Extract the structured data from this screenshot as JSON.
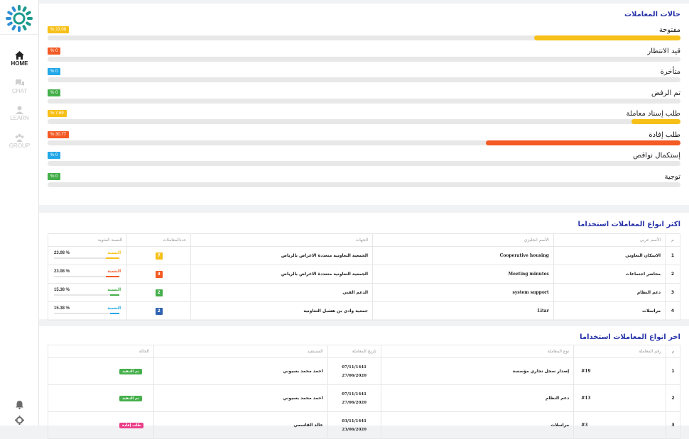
{
  "nav": {
    "items": [
      {
        "label": "HOME",
        "icon": "home-icon",
        "active": true
      },
      {
        "label": "CHAT",
        "icon": "chat-icon",
        "active": false
      },
      {
        "label": "LEARN",
        "icon": "learn-icon",
        "active": false
      },
      {
        "label": "GROUP",
        "icon": "group-icon",
        "active": false
      }
    ],
    "bottom_icons": [
      "bell-icon",
      "gear-icon"
    ]
  },
  "colors": {
    "yellow": "#f7c018",
    "red": "#f35a24",
    "blue": "#22a7e8",
    "green": "#44af4a",
    "darkblue": "#2f62b1",
    "pink": "#ec3f8a",
    "title": "#2633a8"
  },
  "status_card": {
    "title": "حالات المعاملات",
    "rows": [
      {
        "label": "مفتوحة",
        "badge": "% 23.08",
        "percent": 23.08,
        "color": "#f7c018"
      },
      {
        "label": "قيد الانتظار",
        "badge": "% 0",
        "percent": 0,
        "color": "#f35a24"
      },
      {
        "label": "متأخرة",
        "badge": "% 0",
        "percent": 0,
        "color": "#22a7e8"
      },
      {
        "label": "تم الرفض",
        "badge": "% 0",
        "percent": 0,
        "color": "#44af4a"
      },
      {
        "label": "طلب إسناد معاملة",
        "badge": "% 7.69",
        "percent": 7.69,
        "color": "#f7c018"
      },
      {
        "label": "طلب إفادة",
        "badge": "% 30.77",
        "percent": 30.77,
        "color": "#f35a24"
      },
      {
        "label": "إستكمال نواقص",
        "badge": "% 0",
        "percent": 0,
        "color": "#22a7e8"
      },
      {
        "label": "توجية",
        "badge": "% 0",
        "percent": 0,
        "color": "#44af4a"
      }
    ]
  },
  "top_types": {
    "title": "اكثر انواع المعاملات استخداما",
    "headers": {
      "num": "م",
      "arabic": "الأسم عربي",
      "english": "الأسم انجليزي",
      "entities": "الجهات",
      "count": "عددالمعاملات",
      "ratio": "النسبة المئوية"
    },
    "ratio_label": "النسبة",
    "rows": [
      {
        "num": "1",
        "arabic": "الاسكان التعاوني",
        "english": "Cooperative housing",
        "entity": "الجمعية التعاونية متعددة الاغراض بالرياض",
        "count": "7",
        "count_color": "#f7c018",
        "pct": "% 23.08",
        "pct_value": 23.08,
        "bar_color": "#f7c018"
      },
      {
        "num": "2",
        "arabic": "محاضر اجتماعات",
        "english": "Meeting minutes",
        "entity": "الجمعية التعاونية متعددة الاغراض بالرياض",
        "count": "3",
        "count_color": "#f35a24",
        "pct": "% 23.08",
        "pct_value": 23.08,
        "bar_color": "#f35a24"
      },
      {
        "num": "3",
        "arabic": "دعم النظام",
        "english": "system support",
        "entity": "الدعم الفني",
        "count": "2",
        "count_color": "#44af4a",
        "pct": "% 15.38",
        "pct_value": 15.38,
        "bar_color": "#44af4a"
      },
      {
        "num": "4",
        "arabic": "مراسلات",
        "english": "Litar",
        "entity": "جمعية وادي بن هشبل التعاونية",
        "count": "2",
        "count_color": "#2f62b1",
        "pct": "% 15.38",
        "pct_value": 15.38,
        "bar_color": "#22a7e8"
      }
    ]
  },
  "last_types": {
    "title": "اخر انواع المعاملات استخداما",
    "headers": {
      "num": "م",
      "id": "رقم المعاملة",
      "type": "نوع المعاملة",
      "date": "تاريخ المعاملة",
      "beneficiary": "المستفيد",
      "status": "الحالة"
    },
    "rows": [
      {
        "num": "1",
        "id": "#19",
        "type": "إصدار سجل تجاري مؤسسة",
        "date_h": "07/11/1441",
        "date_g": "27/06/2020",
        "beneficiary": "احمد محمد بسيوني",
        "status": "تم التنفيذ",
        "status_color": "#44af4a"
      },
      {
        "num": "2",
        "id": "#13",
        "type": "دعم النظام",
        "date_h": "07/11/1441",
        "date_g": "27/06/2020",
        "beneficiary": "احمد محمد بسيوني",
        "status": "تم التنفيذ",
        "status_color": "#44af4a"
      },
      {
        "num": "3",
        "id": "#3",
        "type": "مراسلات",
        "date_h": "03/11/1441",
        "date_g": "23/06/2020",
        "beneficiary": "خالد القاسمي",
        "status": "طلب إفادة",
        "status_color": "#ec3f8a"
      }
    ]
  }
}
